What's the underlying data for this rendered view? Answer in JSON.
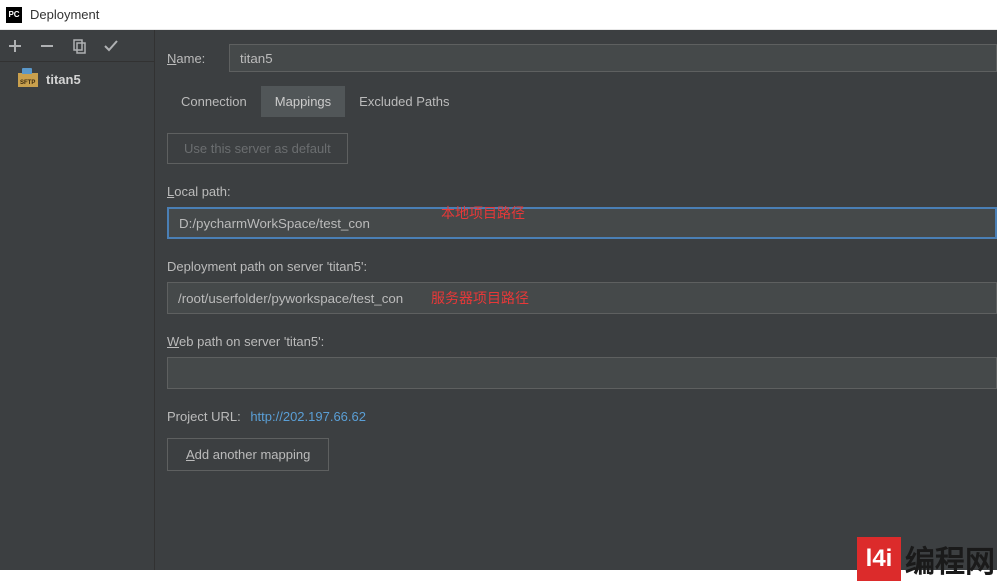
{
  "window": {
    "title": "Deployment",
    "app_icon": "PC"
  },
  "toolbar": {
    "add": "add-icon",
    "remove": "remove-icon",
    "copy": "copy-icon",
    "apply": "checkmark-icon"
  },
  "server_list": {
    "items": [
      {
        "badge": "SFTP",
        "name": "titan5"
      }
    ]
  },
  "form": {
    "name_label_prefix": "N",
    "name_label_rest": "ame:",
    "name_value": "titan5",
    "tabs": {
      "connection": "Connection",
      "mappings": "Mappings",
      "excluded": "Excluded Paths"
    },
    "default_button": "Use this server as default",
    "local_path_label_prefix": "L",
    "local_path_label_rest": "ocal path:",
    "local_path_value": "D:/pycharmWorkSpace/test_con",
    "deployment_label": "Deployment path on server 'titan5':",
    "deployment_value": "/root/userfolder/pyworkspace/test_con",
    "web_label_prefix": "W",
    "web_label_rest": "eb path on server 'titan5':",
    "web_value": "",
    "project_url_label": "Project URL:",
    "project_url_value": "http://202.197.66.62",
    "add_mapping_prefix": "A",
    "add_mapping_rest": "dd another mapping"
  },
  "annotations": {
    "local": "本地项目路径",
    "server": "服务器项目路径"
  },
  "watermark": {
    "badge": "l4i",
    "text": "编程网"
  }
}
